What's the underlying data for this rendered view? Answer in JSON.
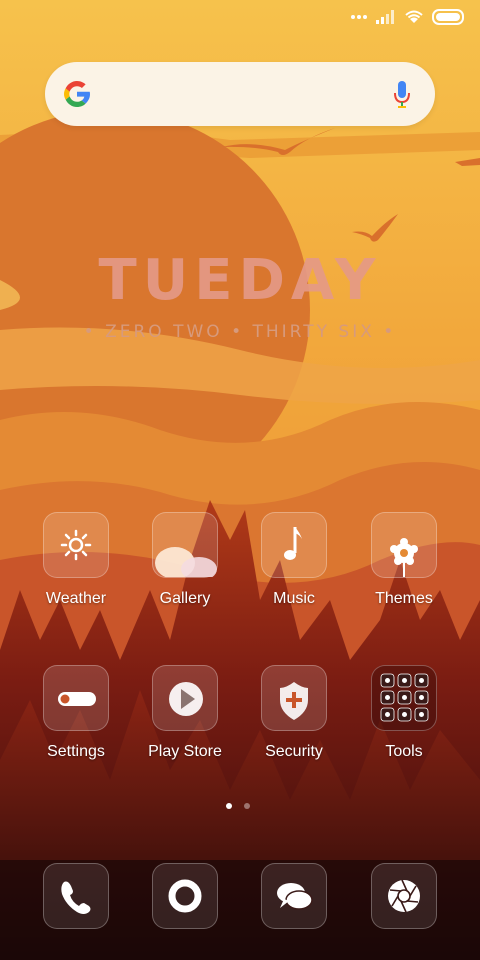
{
  "status_bar": {
    "icons": [
      "more-dots-icon",
      "signal-icon",
      "wifi-icon",
      "battery-icon"
    ]
  },
  "search": {
    "logo": "google-logo-icon",
    "mic": "mic-icon"
  },
  "clock_widget": {
    "day": "TUEDAY",
    "time": "• ZERO TWO • THIRTY SIX •"
  },
  "apps": [
    {
      "label": "Weather",
      "icon": "weather-sun-icon"
    },
    {
      "label": "Gallery",
      "icon": "gallery-clouds-icon"
    },
    {
      "label": "Music",
      "icon": "music-note-icon"
    },
    {
      "label": "Themes",
      "icon": "themes-flower-icon"
    },
    {
      "label": "Settings",
      "icon": "settings-toggle-icon"
    },
    {
      "label": "Play Store",
      "icon": "play-icon"
    },
    {
      "label": "Security",
      "icon": "security-shield-icon"
    },
    {
      "label": "Tools",
      "icon": "tools-grid-icon"
    }
  ],
  "page_indicator": {
    "pages": 2,
    "active": 1
  },
  "dock": [
    {
      "icon": "phone-icon"
    },
    {
      "icon": "browser-ring-icon"
    },
    {
      "icon": "messages-bubble-icon"
    },
    {
      "icon": "camera-aperture-icon"
    }
  ],
  "colors": {
    "sky_top": "#f6bd4a",
    "sky_mid": "#f0a43a",
    "sun": "#e08a3a",
    "mountains": "#dc7b2f",
    "forest_dark": "#3a0f0c",
    "clock_text": "#e59a88"
  }
}
